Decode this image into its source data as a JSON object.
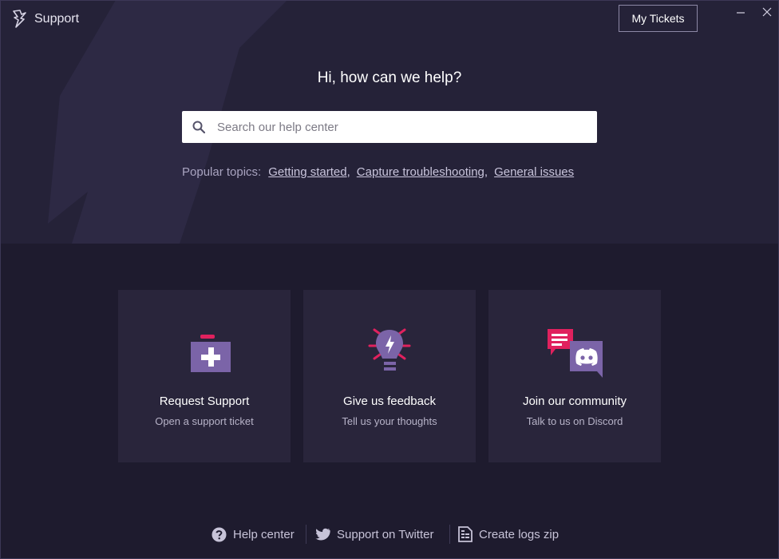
{
  "window": {
    "title": "Support",
    "my_tickets_label": "My Tickets"
  },
  "hero": {
    "headline": "Hi, how can we help?",
    "search_placeholder": "Search our help center",
    "popular_label": "Popular topics:",
    "topics": [
      "Getting started",
      "Capture troubleshooting",
      "General issues"
    ]
  },
  "cards": [
    {
      "title": "Request Support",
      "subtitle": "Open a support ticket",
      "icon": "first-aid-kit-icon"
    },
    {
      "title": "Give us feedback",
      "subtitle": "Tell us your thoughts",
      "icon": "lightbulb-icon"
    },
    {
      "title": "Join our community",
      "subtitle": "Talk to us on Discord",
      "icon": "discord-chat-icon"
    }
  ],
  "footer": {
    "help_center": "Help center",
    "twitter": "Support on Twitter",
    "logs": "Create logs zip"
  },
  "colors": {
    "accent_purple": "#7b64a8",
    "accent_pink": "#e0215e",
    "hero_bg": "#252238",
    "page_bg": "#1e1b2e",
    "card_bg": "#29253b"
  }
}
